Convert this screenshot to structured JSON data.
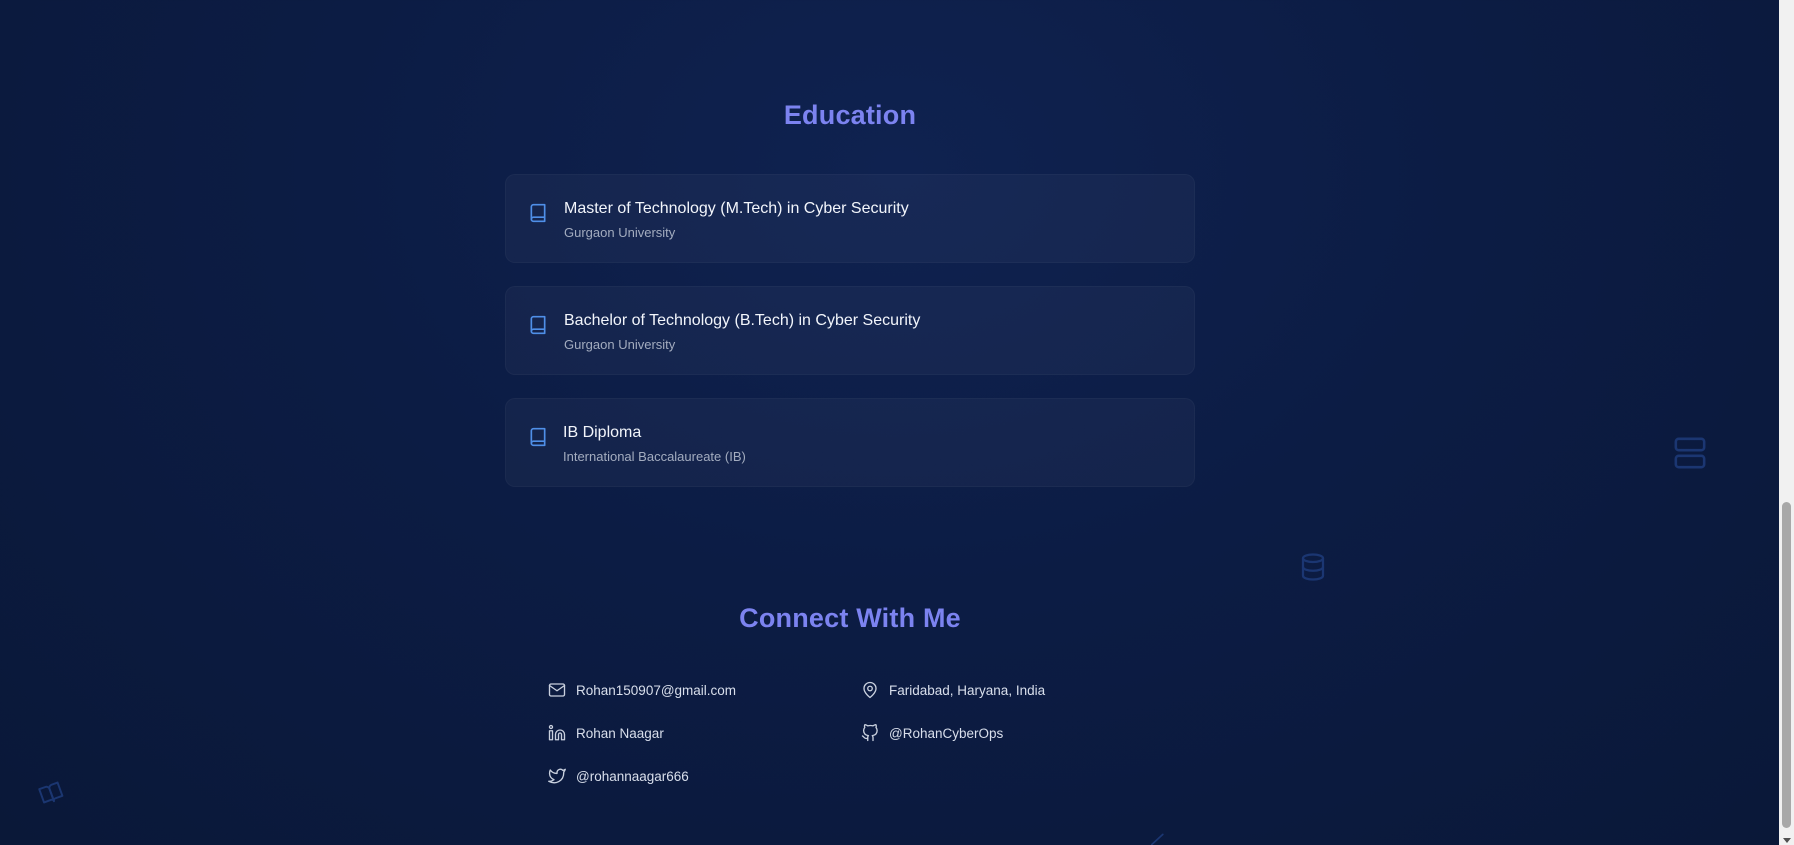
{
  "education": {
    "title": "Education",
    "items": [
      {
        "degree": "Master of Technology (M.Tech) in Cyber Security",
        "school": "Gurgaon University",
        "icon": "book-icon"
      },
      {
        "degree": "Bachelor of Technology (B.Tech) in Cyber Security",
        "school": "Gurgaon University",
        "icon": "book-icon"
      },
      {
        "degree": "IB Diploma",
        "school": "International Baccalaureate (IB)",
        "icon": "book-icon"
      }
    ]
  },
  "connect": {
    "title": "Connect With Me",
    "email": "Rohan150907@gmail.com",
    "location": "Faridabad, Haryana, India",
    "linkedin": "Rohan Naagar",
    "github": "@RohanCyberOps",
    "twitter": "@rohannaagar666"
  },
  "colors": {
    "accent": "#7c83f0",
    "icon_blue": "#4f8fe8",
    "background": "#0c1c44"
  }
}
